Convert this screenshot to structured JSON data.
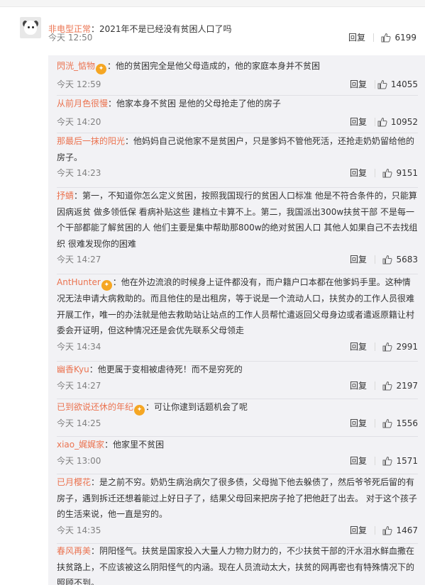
{
  "top_comment": {
    "user": "非电型正常",
    "text": "：2021年不是已经没有贫困人口了吗",
    "time": "今天 12:50",
    "reply_label": "回复",
    "likes": "6199"
  },
  "replies": [
    {
      "user": "閃洸_惦物",
      "badge": true,
      "text": "：他的贫困完全是他父母造成的，他的家庭本身并不贫困",
      "time": "今天 12:59",
      "reply_label": "回复",
      "likes": "14055"
    },
    {
      "user": "从前月色很慢",
      "badge": false,
      "text": "：他家本身不贫困 是他的父母抢走了他的房子",
      "time": "今天 14:20",
      "reply_label": "回复",
      "likes": "10952"
    },
    {
      "user": "那最后一抹的阳光",
      "badge": false,
      "text": "：他妈妈自己说他家不是贫困户，只是爹妈不管他死活，还抢走奶奶留给他的房子。",
      "time": "今天 14:23",
      "reply_label": "回复",
      "likes": "9151"
    },
    {
      "user": "抒蜻",
      "badge": false,
      "text": "：第一，不知道你怎么定义贫困，按照我国现行的贫困人口标准 他是不符合条件的，只能算因病返贫 做多领低保 看病补贴这些 建档立卡算不上。第二，我国派出300w扶贫干部 不是每一个干部都能了解贫困的人 他们主要是集中帮助那800w的绝对贫困人口 其他人如果自己不去找组织 很难发现你的困难",
      "time": "今天 14:27",
      "reply_label": "回复",
      "likes": "5683"
    },
    {
      "user": "AntHunter",
      "badge": true,
      "text": "：他在外边流浪的时候身上证件都没有，而户籍户口本都在他爹妈手里。这种情况无法申请大病救助的。而且他住的是出租房，等于说是一个流动人口，扶贫办的工作人员很难开展工作，唯一的办法就是他去救助站让站点的工作人员帮忙遣返回父母身边或者遣返原籍让村委会开证明，但这种情况还是会优先联系父母领走",
      "time": "今天 14:34",
      "reply_label": "回复",
      "likes": "2991"
    },
    {
      "user": "幽香Kyu",
      "badge": false,
      "text": "：他更属于变相被虐待死！而不是穷死的",
      "time": "今天 14:27",
      "reply_label": "回复",
      "likes": "2197"
    },
    {
      "user": "已到欲说还休的年纪",
      "badge": true,
      "text": "：可让你逮到话题机会了呢",
      "time": "今天 14:25",
      "reply_label": "回复",
      "likes": "1556"
    },
    {
      "user": "xiao_娓娓家",
      "badge": false,
      "text": "：他家里不贫困",
      "time": "今天 13:00",
      "reply_label": "回复",
      "likes": "1571"
    },
    {
      "user": "已月樱花",
      "badge": false,
      "text": "：是之前不穷。奶奶生病治病欠了很多债，父母抛下他去躲债了，然后爷爷死后留的有房子，遇到拆迁还想着能过上好日子了，结果父母回来把房子抢了把他赶了出去。 对于这个孩子的生活来说，他一直是穷的。",
      "time": "今天 14:35",
      "reply_label": "回复",
      "likes": "1467"
    },
    {
      "user": "春风再美",
      "badge": false,
      "text": "：阴阳怪气。扶贫是国家投入大量人力物力财力的，不少扶贫干部的汗水泪水鲜血撒在扶贫路上，不应该被这么阴阳怪气的内涵。现在人员流动太大，扶贫的网再密也有特殊情况下的照顾不到。",
      "time": "",
      "reply_label": "",
      "likes": ""
    }
  ]
}
